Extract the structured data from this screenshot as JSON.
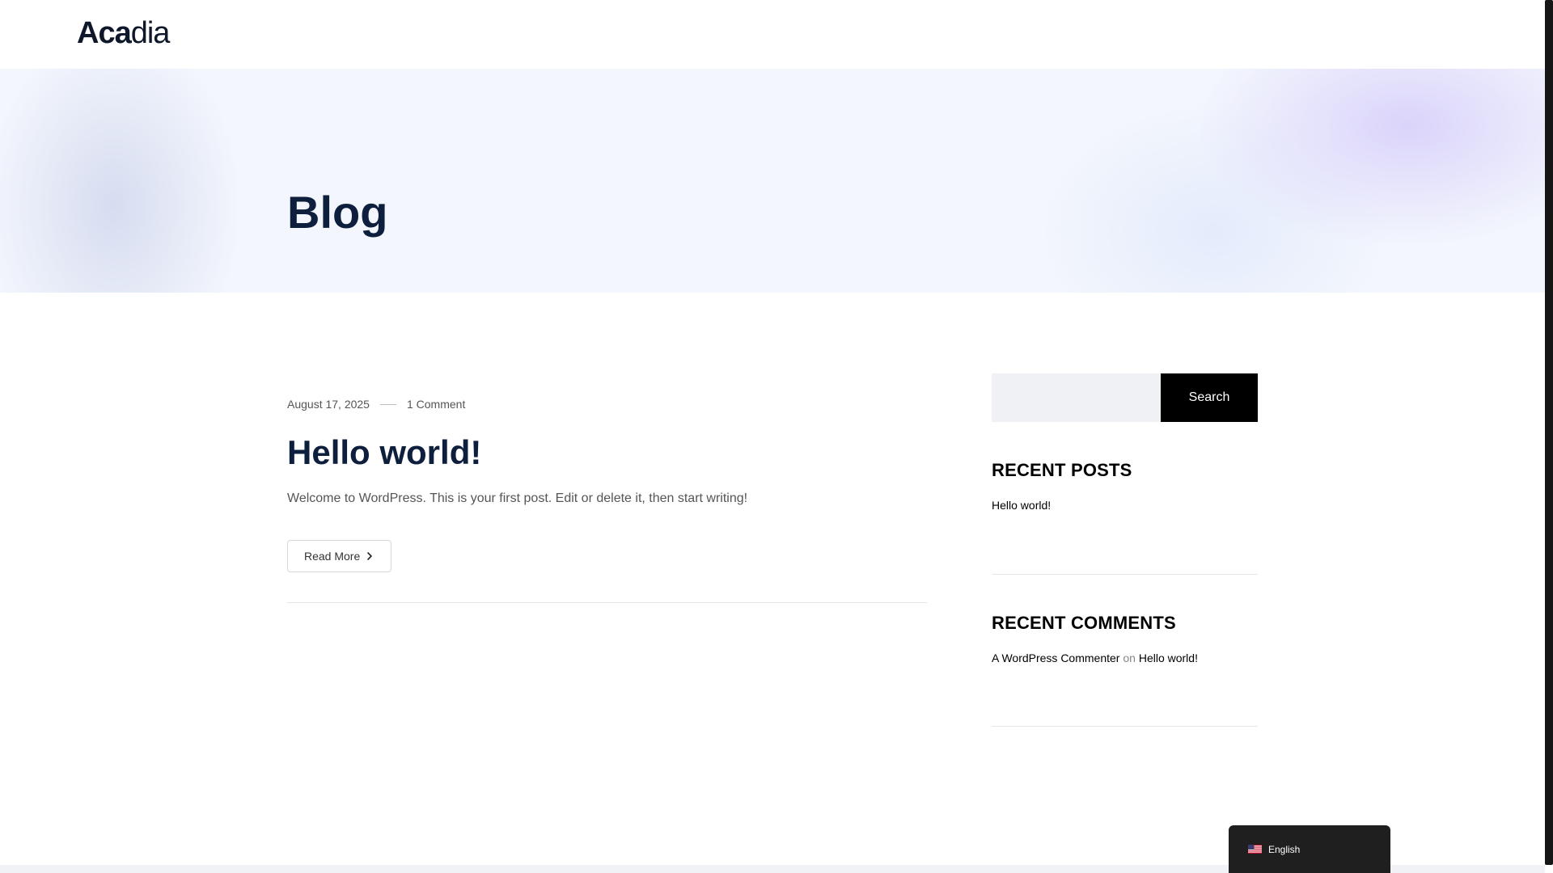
{
  "header": {
    "logo_bold": "Aca",
    "logo_light": "dia"
  },
  "hero": {
    "title": "Blog"
  },
  "post": {
    "date": "August 17, 2025",
    "comments": "1 Comment",
    "title": "Hello world!",
    "excerpt": "Welcome to WordPress. This is your first post. Edit or delete it, then start writing!",
    "read_more": "Read More"
  },
  "sidebar": {
    "search": {
      "placeholder": "",
      "value": "",
      "button_label": "Search"
    },
    "recent_posts": {
      "title": "RECENT POSTS",
      "items": [
        {
          "label": "Hello world!"
        }
      ]
    },
    "recent_comments": {
      "title": "RECENT COMMENTS",
      "items": [
        {
          "author": "A WordPress Commenter",
          "on": "on",
          "post": "Hello world!"
        }
      ]
    }
  },
  "language_switcher": {
    "label": "English",
    "flag_icon": "us-flag-icon"
  },
  "colors": {
    "heading": "#0e1f3d",
    "button_dark": "#000000",
    "hero_bg": "#f3f6fd"
  }
}
